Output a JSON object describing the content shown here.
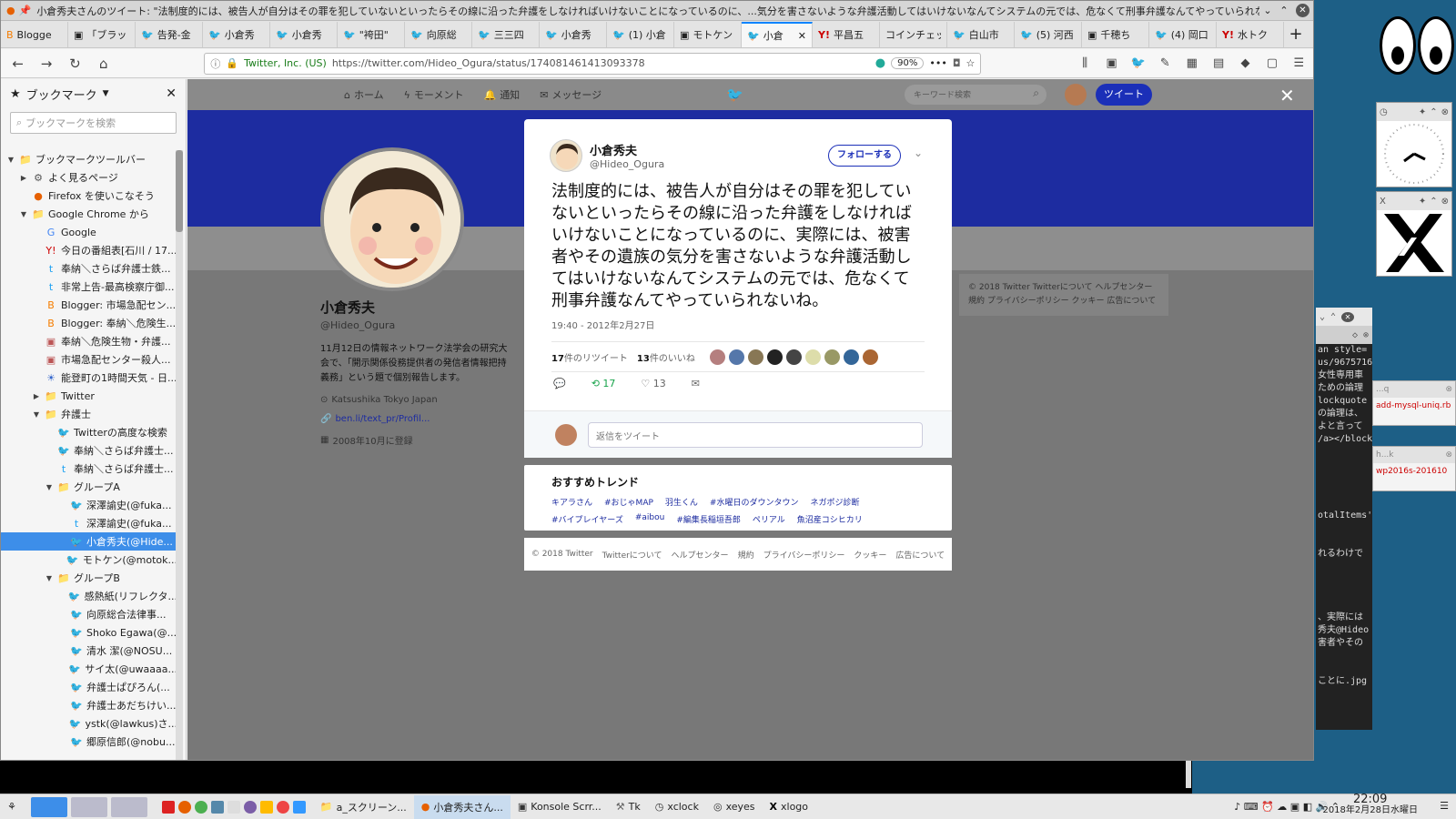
{
  "window": {
    "title": "小倉秀夫さんのツイート: \"法制度的には、被告人が自分はその罪を犯していないといったらその線に沿った弁護をしなければいけないことになっているのに、...気分を害さないような弁護活動してはいけないなんてシステムの元では、危なくて刑事弁護なんてやっていられないね。\" - Mozilla Firefox"
  },
  "tabs": [
    {
      "label": "Blogge",
      "icon": "blogger"
    },
    {
      "label": "「ブラッ",
      "icon": "page"
    },
    {
      "label": "告発-金",
      "icon": "twitter"
    },
    {
      "label": "小倉秀",
      "icon": "twitter"
    },
    {
      "label": "小倉秀",
      "icon": "twitter"
    },
    {
      "label": "\"袴田\"",
      "icon": "twitter"
    },
    {
      "label": "向原総",
      "icon": "twitter"
    },
    {
      "label": "三三四",
      "icon": "twitter"
    },
    {
      "label": "小倉秀",
      "icon": "twitter"
    },
    {
      "label": "(1) 小倉",
      "icon": "twitter"
    },
    {
      "label": "モトケン",
      "icon": "page"
    },
    {
      "label": "小倉",
      "icon": "twitter",
      "active": true
    },
    {
      "label": "平昌五",
      "icon": "yahoo"
    },
    {
      "label": "コインチェッ",
      "icon": "none"
    },
    {
      "label": "白山市",
      "icon": "twitter"
    },
    {
      "label": "(5) 河西",
      "icon": "twitter"
    },
    {
      "label": "千穂ち",
      "icon": "page"
    },
    {
      "label": "(4) 岡口",
      "icon": "twitter"
    },
    {
      "label": "水トク",
      "icon": "yahoo"
    }
  ],
  "urlbar": {
    "identity": "Twitter, Inc. (US)",
    "url": "https://twitter.com/Hideo_Ogura/status/174081461413093378",
    "zoom": "90%"
  },
  "sidebar": {
    "title": "ブックマーク",
    "search_placeholder": "ブックマークを検索",
    "items": [
      {
        "label": "ブックマークツールバー",
        "level": 0,
        "type": "folder",
        "open": true
      },
      {
        "label": "よく見るページ",
        "level": 1,
        "type": "gear",
        "open": false
      },
      {
        "label": "Firefox を使いこなそう",
        "level": 1,
        "type": "firefox"
      },
      {
        "label": "Google Chrome から",
        "level": 1,
        "type": "folder",
        "open": true
      },
      {
        "label": "Google",
        "level": 2,
        "type": "google"
      },
      {
        "label": "今日の番組表[石川 / 17...",
        "level": 2,
        "type": "yahoo"
      },
      {
        "label": "奉納＼さらば弁護士鉄...",
        "level": 2,
        "type": "blue"
      },
      {
        "label": "非常上告-最高検察庁御...",
        "level": 2,
        "type": "blue"
      },
      {
        "label": "Blogger: 市場急配セン...",
        "level": 2,
        "type": "blogger"
      },
      {
        "label": "Blogger: 奉納＼危険生...",
        "level": 2,
        "type": "blogger"
      },
      {
        "label": "奉納＼危険生物・弁護...",
        "level": 2,
        "type": "page"
      },
      {
        "label": "市場急配センター殺人...",
        "level": 2,
        "type": "page"
      },
      {
        "label": "能登町の1時間天気 - 日...",
        "level": 2,
        "type": "weather"
      },
      {
        "label": "Twitter",
        "level": 2,
        "type": "folder",
        "open": false
      },
      {
        "label": "弁護士",
        "level": 2,
        "type": "folder",
        "open": true
      },
      {
        "label": "Twitterの高度な検索",
        "level": 3,
        "type": "twitter"
      },
      {
        "label": "奉納＼さらば弁護士...",
        "level": 3,
        "type": "twitter"
      },
      {
        "label": "奉納＼さらば弁護士...",
        "level": 3,
        "type": "blue"
      },
      {
        "label": "グループA",
        "level": 3,
        "type": "folder",
        "open": true
      },
      {
        "label": "深澤諭史(@fuka...",
        "level": 4,
        "type": "twitter"
      },
      {
        "label": "深澤諭史(@fuka...",
        "level": 4,
        "type": "blue"
      },
      {
        "label": "小倉秀夫(@Hide...",
        "level": 4,
        "type": "twitter",
        "selected": true
      },
      {
        "label": "モトケン(@motok...",
        "level": 4,
        "type": "twitter"
      },
      {
        "label": "グループB",
        "level": 3,
        "type": "folder",
        "open": true
      },
      {
        "label": "感熱紙(リフレクタ...",
        "level": 4,
        "type": "twitter"
      },
      {
        "label": "向原総合法律事...",
        "level": 4,
        "type": "twitter"
      },
      {
        "label": "Shoko Egawa(@...",
        "level": 4,
        "type": "twitter"
      },
      {
        "label": "清水 潔(@NOSU...",
        "level": 4,
        "type": "twitter"
      },
      {
        "label": "サイ太(@uwaaaa...",
        "level": 4,
        "type": "twitter"
      },
      {
        "label": "弁護士ぱぴろん(...",
        "level": 4,
        "type": "twitter"
      },
      {
        "label": "弁護士あだちけい...",
        "level": 4,
        "type": "twitter"
      },
      {
        "label": "ystk(@lawkus)さ...",
        "level": 4,
        "type": "twitter"
      },
      {
        "label": "郷原信郎(@nobu...",
        "level": 4,
        "type": "twitter"
      }
    ]
  },
  "twitter_nav": {
    "home": "ホーム",
    "moments": "モーメント",
    "notifications": "通知",
    "messages": "メッセージ",
    "search_placeholder": "キーワード検索",
    "tweet_button": "ツイート"
  },
  "profile": {
    "name": "小倉秀夫",
    "handle": "@Hideo_Ogura",
    "bio": "11月12日の情報ネットワーク法学会の研究大会で、「開示関係役務提供者の発信者情報把持義務」という題で個別報告します。",
    "location": "Katsushika Tokyo Japan",
    "link": "ben.li/text_pr/Profil...",
    "joined": "2008年10月に登録"
  },
  "right_footer": {
    "line1": "© 2018 Twitter  Twitterについて  ヘルプセンター",
    "line2": "規約  プライバシーポリシー  クッキー  広告について"
  },
  "tweet": {
    "name": "小倉秀夫",
    "handle": "@Hideo_Ogura",
    "follow_label": "フォローする",
    "text": "法制度的には、被告人が自分はその罪を犯していないといったらその線に沿った弁護をしなければいけないことになっているのに、実際には、被害者やその遺族の気分を害さないような弁護活動してはいけないなんてシステムの元では、危なくて刑事弁護なんてやっていられないね。",
    "timestamp": "19:40 - 2012年2月27日",
    "retweets": "17",
    "retweets_label": "件のリツイート",
    "likes": "13",
    "likes_label": "件のいいね",
    "action_retweets": "17",
    "action_likes": "13",
    "reply_placeholder": "返信をツイート",
    "liker_colors": [
      "#b57f7f",
      "#5577aa",
      "#887755",
      "#222222",
      "#444444",
      "#ddddaa",
      "#999966",
      "#336699",
      "#aa6633"
    ]
  },
  "trends": {
    "title": "おすすめトレンド",
    "items": [
      "キアラさん",
      "#おじゃMAP",
      "羽生くん",
      "#水曜日のダウンタウン",
      "ネガポジ診断",
      "#バイプレイヤーズ",
      "#aibou",
      "#編集長稲垣吾郎",
      "ペリアル",
      "魚沼産コシヒカリ"
    ]
  },
  "content_footer": [
    "© 2018 Twitter",
    "Twitterについて",
    "ヘルプセンター",
    "規約",
    "プライバシーポリシー",
    "クッキー",
    "広告について"
  ],
  "taskbar": {
    "items": [
      {
        "label": "a_スクリーン...",
        "icon": "folder"
      },
      {
        "label": "小倉秀夫さん...",
        "icon": "firefox",
        "active": true
      },
      {
        "label": "Konsole Scrr...",
        "icon": "terminal"
      },
      {
        "label": "Tk",
        "icon": "tk"
      },
      {
        "label": "xclock",
        "icon": "clock"
      },
      {
        "label": "xeyes",
        "icon": "eyes"
      },
      {
        "label": "xlogo",
        "icon": "x"
      }
    ],
    "time": "22:09",
    "date": "2018年2月28日水曜日"
  },
  "konsole": {
    "lines": [
      "an style=",
      "us/9675716",
      "女性専用車",
      "ための論理",
      "lockquote",
      "の論理は、",
      "よと言って",
      "/a></block",
      "",
      "",
      "",
      "",
      "",
      "otalItems'",
      "",
      "",
      "れるわけで",
      "",
      "",
      "",
      "",
      "、実際には",
      "秀夫@Hideo",
      "害者やその",
      "",
      "",
      "ことに.jpg"
    ]
  },
  "mini_windows": [
    {
      "title": "...q",
      "body": "add-mysql-uniq.rb"
    },
    {
      "title": "h...k",
      "body": "wp2016s-201610"
    }
  ]
}
